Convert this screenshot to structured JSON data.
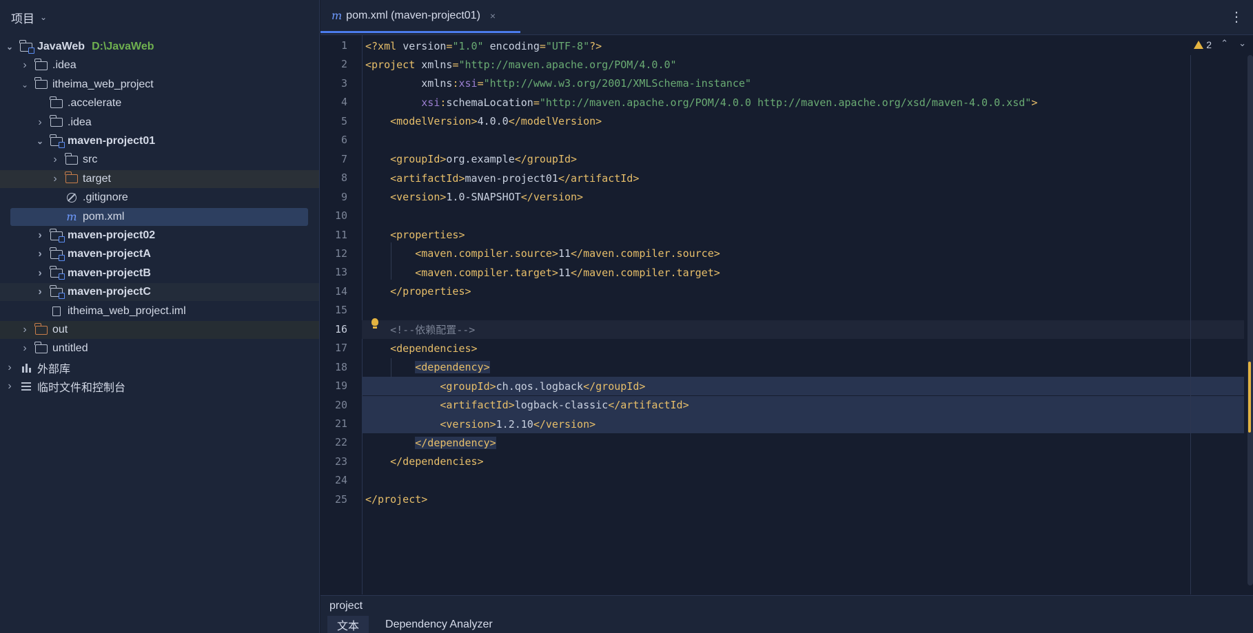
{
  "panel": {
    "title": "项目"
  },
  "tree": [
    {
      "label": "JavaWeb",
      "path": "D:\\JavaWeb",
      "icon": "module-folder-icon",
      "depth": 0,
      "expanded": true,
      "bold": true
    },
    {
      "label": ".idea",
      "icon": "folder-icon",
      "depth": 1,
      "expanded": false
    },
    {
      "label": "itheima_web_project",
      "icon": "folder-icon",
      "depth": 1,
      "expanded": true
    },
    {
      "label": ".accelerate",
      "icon": "folder-icon",
      "depth": 2,
      "leaf": true
    },
    {
      "label": ".idea",
      "icon": "folder-icon",
      "depth": 2,
      "expanded": false
    },
    {
      "label": "maven-project01",
      "icon": "module-folder-icon",
      "depth": 2,
      "expanded": true,
      "bold": true
    },
    {
      "label": "src",
      "icon": "folder-icon",
      "depth": 3,
      "expanded": false
    },
    {
      "label": "target",
      "icon": "excluded-folder-icon",
      "depth": 3,
      "expanded": false
    },
    {
      "label": ".gitignore",
      "icon": "gitignore-icon",
      "depth": 3,
      "leaf": true
    },
    {
      "label": "pom.xml",
      "icon": "maven-icon",
      "depth": 3,
      "leaf": true,
      "selected": true
    },
    {
      "label": "maven-project02",
      "icon": "module-folder-icon",
      "depth": 2,
      "expanded": false,
      "bold": true
    },
    {
      "label": "maven-projectA",
      "icon": "module-folder-icon",
      "depth": 2,
      "expanded": false,
      "bold": true
    },
    {
      "label": "maven-projectB",
      "icon": "module-folder-icon",
      "depth": 2,
      "expanded": false,
      "bold": true
    },
    {
      "label": "maven-projectC",
      "icon": "module-folder-icon",
      "depth": 2,
      "expanded": false,
      "bold": true
    },
    {
      "label": "itheima_web_project.iml",
      "icon": "iml-file-icon",
      "depth": 2,
      "leaf": true
    },
    {
      "label": "out",
      "icon": "excluded-folder-icon",
      "depth": 1,
      "expanded": false
    },
    {
      "label": "untitled",
      "icon": "folder-icon",
      "depth": 1,
      "expanded": false
    },
    {
      "label": "外部库",
      "icon": "library-icon",
      "depth": 0,
      "expanded": false
    },
    {
      "label": "临时文件和控制台",
      "icon": "scratch-icon",
      "depth": 0,
      "expanded": false
    }
  ],
  "tab": {
    "label": "pom.xml (maven-project01)",
    "close": "×"
  },
  "editor": {
    "warnings": "2",
    "current_line": 16,
    "selection": [
      18,
      22
    ],
    "lines": [
      [
        [
          "tag",
          "<?xml "
        ],
        [
          "attr",
          "version"
        ],
        [
          "tag",
          "="
        ],
        [
          "str",
          "\"1.0\""
        ],
        [
          "attr",
          " encoding"
        ],
        [
          "tag",
          "="
        ],
        [
          "str",
          "\"UTF-8\""
        ],
        [
          "tag",
          "?>"
        ]
      ],
      [
        [
          "tag",
          "<project "
        ],
        [
          "attr",
          "xmlns"
        ],
        [
          "tag",
          "="
        ],
        [
          "str",
          "\"http://maven.apache.org/POM/4.0.0\""
        ]
      ],
      [
        [
          "attr",
          "         xmlns"
        ],
        [
          "tag",
          ":"
        ],
        [
          "ns",
          "xsi"
        ],
        [
          "tag",
          "="
        ],
        [
          "str",
          "\"http://www.w3.org/2001/XMLSchema-instance\""
        ]
      ],
      [
        [
          "ns",
          "         xsi"
        ],
        [
          "tag",
          ":"
        ],
        [
          "attr",
          "schemaLocation"
        ],
        [
          "tag",
          "="
        ],
        [
          "str",
          "\"http://maven.apache.org/POM/4.0.0 http://maven.apache.org/xsd/maven-4.0.0.xsd\""
        ],
        [
          "tag",
          ">"
        ]
      ],
      [
        [
          "tag",
          "    <modelVersion>"
        ],
        [
          "txt",
          "4.0.0"
        ],
        [
          "tag",
          "</modelVersion>"
        ]
      ],
      [],
      [
        [
          "tag",
          "    <groupId>"
        ],
        [
          "txt",
          "org.example"
        ],
        [
          "tag",
          "</groupId>"
        ]
      ],
      [
        [
          "tag",
          "    <artifactId>"
        ],
        [
          "txt",
          "maven-project01"
        ],
        [
          "tag",
          "</artifactId>"
        ]
      ],
      [
        [
          "tag",
          "    <version>"
        ],
        [
          "txt",
          "1.0-SNAPSHOT"
        ],
        [
          "tag",
          "</version>"
        ]
      ],
      [],
      [
        [
          "tag",
          "    <properties>"
        ]
      ],
      [
        [
          "tag",
          "        <maven.compiler.source>"
        ],
        [
          "txt",
          "11"
        ],
        [
          "tag",
          "</maven.compiler.source>"
        ]
      ],
      [
        [
          "tag",
          "        <maven.compiler.target>"
        ],
        [
          "txt",
          "11"
        ],
        [
          "tag",
          "</maven.compiler.target>"
        ]
      ],
      [
        [
          "tag",
          "    </properties>"
        ]
      ],
      [],
      [
        [
          "com",
          "    <!--依赖配置-->"
        ]
      ],
      [
        [
          "tag",
          "    <dependencies>"
        ]
      ],
      [
        [
          "tag",
          "        <dependency>"
        ]
      ],
      [
        [
          "tag",
          "            <groupId>"
        ],
        [
          "txt",
          "ch.qos.logback"
        ],
        [
          "tag",
          "</groupId>"
        ]
      ],
      [
        [
          "tag",
          "            <artifactId>"
        ],
        [
          "txt",
          "logback-classic"
        ],
        [
          "tag",
          "</artifactId>"
        ]
      ],
      [
        [
          "tag",
          "            <version>"
        ],
        [
          "txt",
          "1.2.10"
        ],
        [
          "tag",
          "</version>"
        ]
      ],
      [
        [
          "tag",
          "        </dependency>"
        ]
      ],
      [
        [
          "tag",
          "    </dependencies>"
        ]
      ],
      [],
      [
        [
          "tag",
          "</project>"
        ]
      ]
    ]
  },
  "breadcrumb": "project",
  "bottom_tabs": [
    "文本",
    "Dependency Analyzer"
  ],
  "colors": {
    "accent": "#4b7bec",
    "tag": "#e8bf6a",
    "string": "#6aab73",
    "warning": "#e3b341"
  }
}
